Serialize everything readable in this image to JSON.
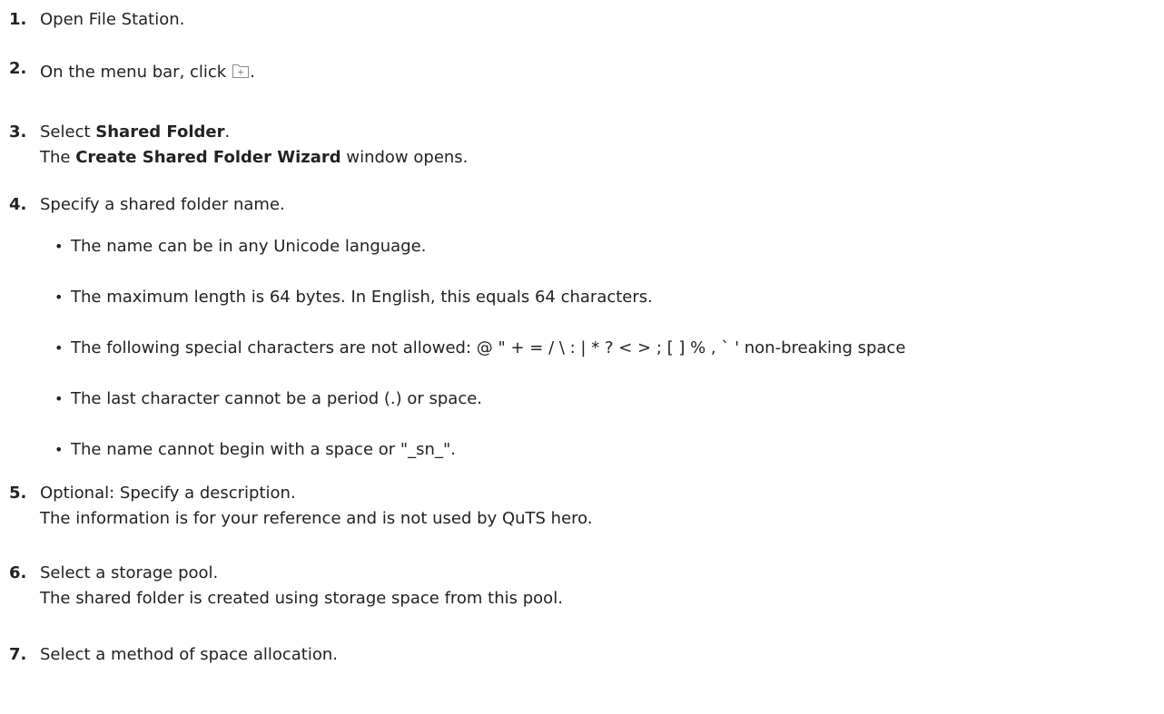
{
  "steps": [
    {
      "num": "1.",
      "text": "Open File Station."
    },
    {
      "num": "2.",
      "before_icon": "On the menu bar, click",
      "icon": "new-folder-icon",
      "after_icon": "."
    },
    {
      "num": "3.",
      "line1_prefix": "Select ",
      "line1_bold": "Shared Folder",
      "line1_suffix": ".",
      "line2_prefix": "The ",
      "line2_bold": "Create Shared Folder Wizard",
      "line2_suffix": " window opens."
    },
    {
      "num": "4.",
      "text": "Specify a shared folder name.",
      "bullets": [
        "The name can be in any Unicode language.",
        "The maximum length is 64 bytes. In English, this equals 64 characters.",
        "The following special characters are not allowed: @ \" + = / \\ : | * ? < > ; [ ] % , ` ' non-breaking space",
        "The last character cannot be a period (.) or space.",
        "The name cannot begin with a space or \"_sn_\"."
      ]
    },
    {
      "num": "5.",
      "line1": "Optional: Specify a description.",
      "line2": "The information is for your reference and is not used by QuTS hero."
    },
    {
      "num": "6.",
      "line1": "Select a storage pool.",
      "line2": "The shared folder is created using storage space from this pool."
    },
    {
      "num": "7.",
      "text": "Select a method of space allocation."
    }
  ]
}
